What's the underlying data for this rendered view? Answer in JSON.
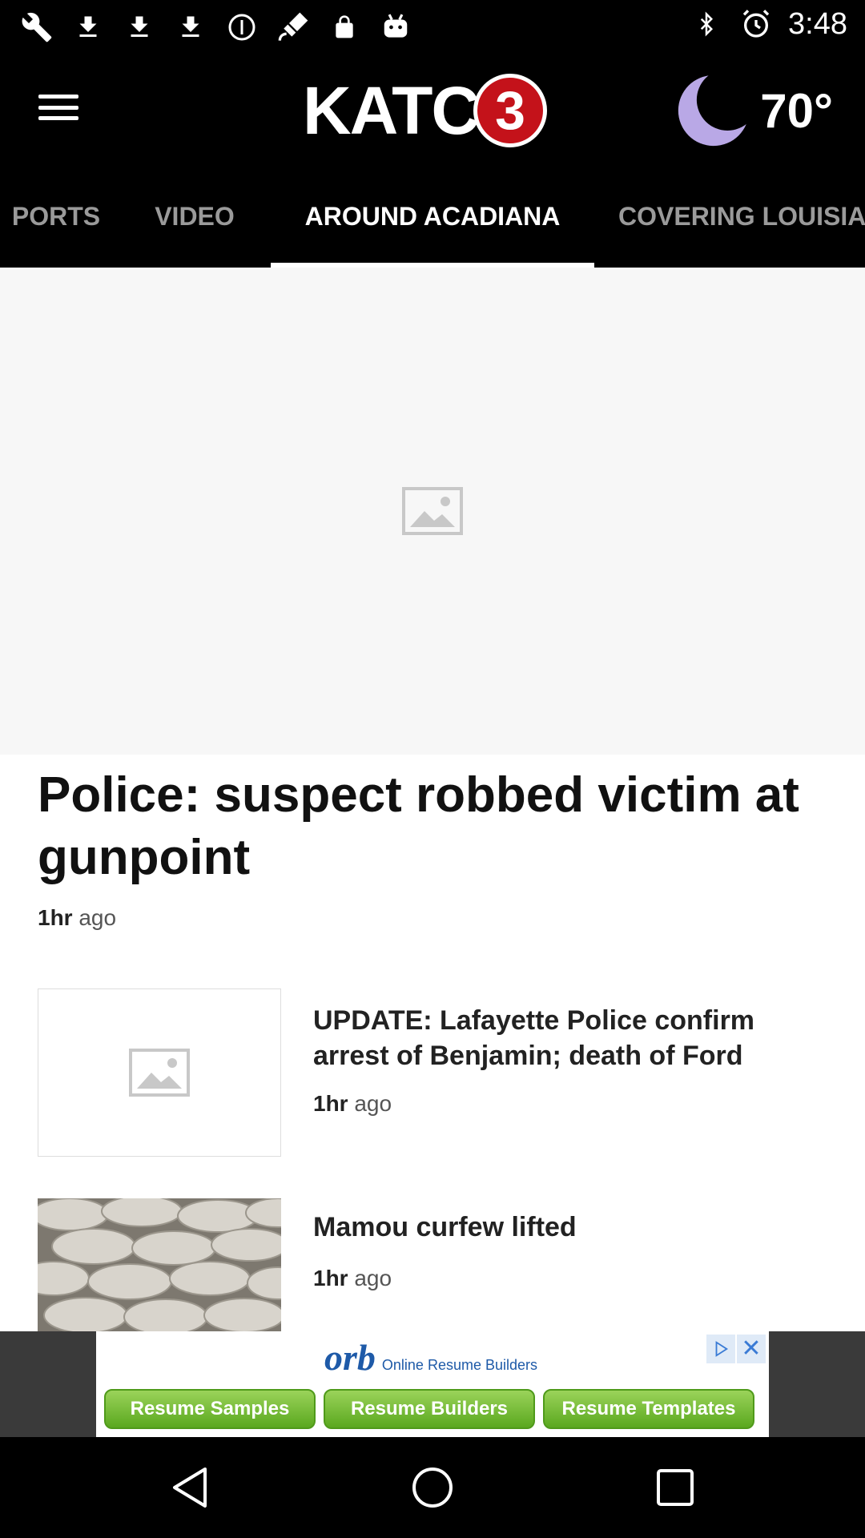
{
  "status_bar": {
    "time": "3:48",
    "left_icons": [
      "wrench-icon",
      "download-icon",
      "download-icon",
      "download-icon",
      "info-icon",
      "satellite-icon",
      "lock-icon",
      "android-icon"
    ],
    "right_icons": [
      "bluetooth-icon",
      "alarm-icon"
    ]
  },
  "header": {
    "logo_text": "KATC",
    "logo_badge": "3",
    "weather": {
      "icon": "moon-icon",
      "temperature": "70°"
    }
  },
  "tabs": [
    {
      "label": "PORTS",
      "active": false
    },
    {
      "label": "VIDEO",
      "active": false
    },
    {
      "label": "AROUND ACADIANA",
      "active": true
    },
    {
      "label": "COVERING LOUISIA",
      "active": false
    }
  ],
  "hero": {
    "title": "Police: suspect robbed victim at gunpoint",
    "time_value": "1hr",
    "time_suffix": "ago"
  },
  "stories": [
    {
      "title": "UPDATE: Lafayette Police confirm arrest of Benjamin; death of Ford",
      "time_value": "1hr",
      "time_suffix": "ago"
    },
    {
      "title": "Mamou curfew lifted",
      "time_value": "1hr",
      "time_suffix": "ago"
    }
  ],
  "ad": {
    "brand": "orb",
    "tagline": "Online Resume Builders",
    "buttons": [
      "Resume Samples",
      "Resume Builders",
      "Resume Templates"
    ]
  },
  "colors": {
    "background": "#000000",
    "accent_red": "#c4121a",
    "moon": "#b9a8e6",
    "ad_green": "#6bb52b"
  }
}
